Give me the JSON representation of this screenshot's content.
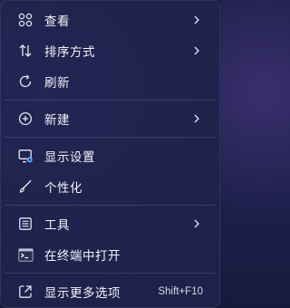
{
  "menu": {
    "groups": [
      {
        "items": [
          {
            "label": "查看",
            "icon": "view-grid-icon",
            "has_submenu": true
          },
          {
            "label": "排序方式",
            "icon": "sort-arrows-icon",
            "has_submenu": true
          },
          {
            "label": "刷新",
            "icon": "refresh-icon",
            "has_submenu": false
          }
        ]
      },
      {
        "items": [
          {
            "label": "新建",
            "icon": "add-circle-icon",
            "has_submenu": true
          }
        ]
      },
      {
        "items": [
          {
            "label": "显示设置",
            "icon": "display-settings-icon",
            "has_submenu": false
          },
          {
            "label": "个性化",
            "icon": "brush-icon",
            "has_submenu": false
          }
        ]
      },
      {
        "items": [
          {
            "label": "工具",
            "icon": "tools-list-icon",
            "has_submenu": true
          },
          {
            "label": "在终端中打开",
            "icon": "terminal-icon",
            "has_submenu": false
          }
        ]
      },
      {
        "items": [
          {
            "label": "显示更多选项",
            "icon": "share-expand-icon",
            "has_submenu": false,
            "shortcut": "Shift+F10"
          }
        ]
      }
    ],
    "colors": {
      "text": "#f2f2f6",
      "icon": "#e6e7f2",
      "accent": "#5aa9ff"
    }
  }
}
